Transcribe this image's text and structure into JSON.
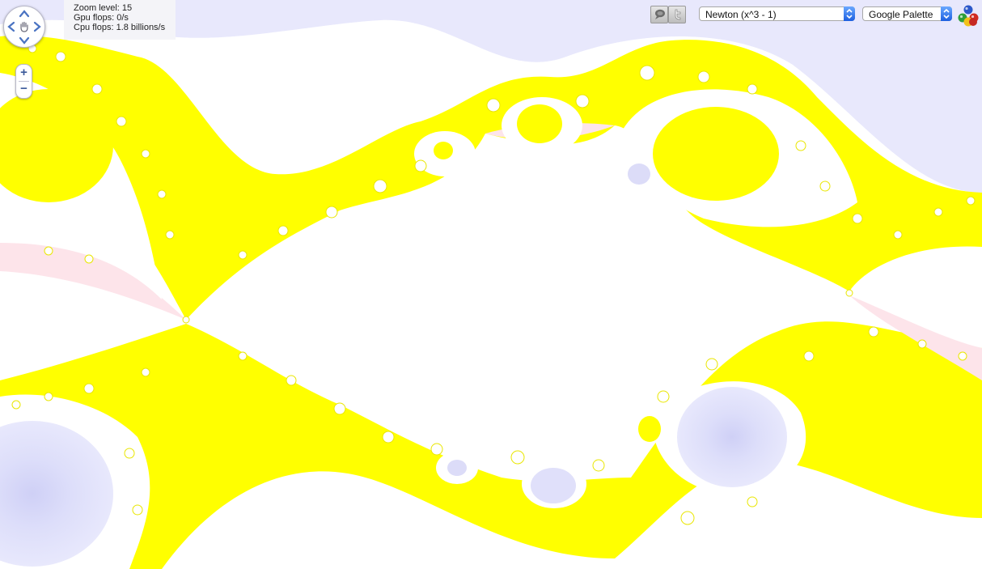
{
  "stats": {
    "zoom": "Zoom level: 15",
    "gpu": "Gpu flops: 0/s",
    "cpu": "Cpu flops: 1.8 billions/s"
  },
  "zoom_controls": {
    "in": "+",
    "out": "−"
  },
  "fractal_select": {
    "value": "Newton (x^3 - 1)"
  },
  "palette_select": {
    "value": "Google Palette"
  },
  "icons": {
    "pan": [
      "up-arrow-icon",
      "down-arrow-icon",
      "left-arrow-icon",
      "right-arrow-icon",
      "hand-icon"
    ],
    "share": [
      "chat-bubble-icon",
      "twitter-icon"
    ],
    "palette": "colored-balls-icon"
  },
  "colors": {
    "yellow": "#ffff00",
    "lavender": "#e8e8fc",
    "pink": "#fde4ea",
    "lime": "#d6f03a",
    "accent_blue": "#1d5fe0"
  }
}
